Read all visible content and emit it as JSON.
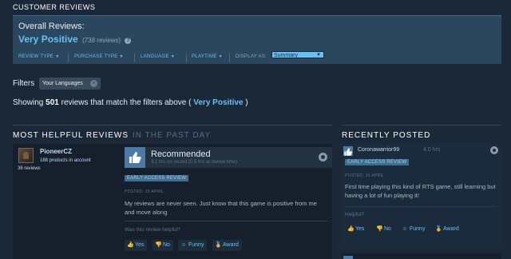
{
  "header": {
    "title": "CUSTOMER REVIEWS"
  },
  "overall": {
    "label": "Overall Reviews:",
    "rating": "Very Positive",
    "count": "(738 reviews)",
    "help_icon": "question-icon"
  },
  "filters_bar": {
    "review_type": "REVIEW TYPE",
    "purchase_type": "PURCHASE TYPE",
    "language": "LANGUAGE",
    "playtime": "PLAYTIME",
    "display_as_label": "DISPLAY AS:",
    "display_as_value": "Summary"
  },
  "filters": {
    "label": "Filters",
    "chip": "Your Languages"
  },
  "showing": {
    "prefix": "Showing",
    "count": "501",
    "middle": "reviews that match the filters above (",
    "rating": "Very Positive",
    "suffix": ")"
  },
  "most_helpful": {
    "title": "MOST HELPFUL REVIEWS",
    "period": "IN THE PAST DAY",
    "review": {
      "username": "PioneerCZ",
      "products": "188 products in account",
      "reviews": "36 reviews",
      "verdict": "Recommended",
      "hours": "3.1 hrs on record (0.5 hrs at review time)",
      "badge": "EARLY ACCESS REVIEW",
      "posted": "POSTED: 26 APRIL",
      "text": "My reviews are never seen. Just know that this game is positive from me and move along",
      "helpful_q": "Was this review helpful?",
      "yes": "Yes",
      "no": "No",
      "funny": "Funny",
      "award": "Award"
    }
  },
  "recently_posted": {
    "title": "RECENTLY POSTED",
    "review": {
      "username": "Coronawarrior99",
      "hours": "4.0 hrs",
      "badge": "EARLY ACCESS REVIEW",
      "posted": "POSTED: 26 APRIL",
      "text": "First time playing this kind of RTS game, still learning but having a lot of fun playing it!",
      "helpful_q": "Helpful?",
      "yes": "Yes",
      "no": "No",
      "funny": "Funny",
      "award": "Award"
    }
  },
  "colors": {
    "background": "#1b2838",
    "accent": "#66c0f4",
    "panel": "#2a475e",
    "recommended_thumb": "#4d7aa5"
  }
}
